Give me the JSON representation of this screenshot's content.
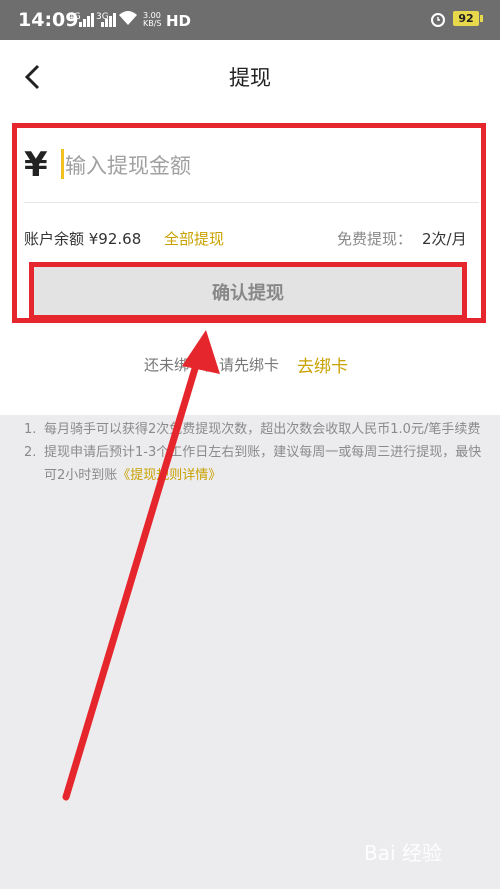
{
  "status_bar": {
    "time": "14:09",
    "net1": "4G",
    "net2": "3G",
    "speed_value": "3.00",
    "speed_unit": "KB/S",
    "hd": "HD",
    "battery": "92"
  },
  "header": {
    "title": "提现",
    "back_icon": "chevron-left-icon"
  },
  "amount": {
    "currency_symbol": "¥",
    "placeholder": "输入提现金额"
  },
  "balance": {
    "text": "账户余额 ¥92.68",
    "withdraw_all": "全部提现",
    "free_label": "免费提现：",
    "free_count": "2次/月"
  },
  "confirm_button": "确认提现",
  "bind_card": {
    "hint": "还未绑卡，请先绑卡",
    "link": "去绑卡"
  },
  "notes": [
    {
      "num": "1.",
      "text": "每月骑手可以获得2次免费提现次数，超出次数会收取人民币1.0元/笔手续费"
    },
    {
      "num": "2.",
      "text": "提现申请后预计1-3个工作日左右到账，建议每周一或每周三进行提现，最快可2小时到账",
      "link": "《提现规则详情》"
    }
  ],
  "watermark": "Bai 经验",
  "colors": {
    "accent": "#c9a100",
    "annotation": "#e6262d",
    "button_bg": "#e3e3e3"
  }
}
